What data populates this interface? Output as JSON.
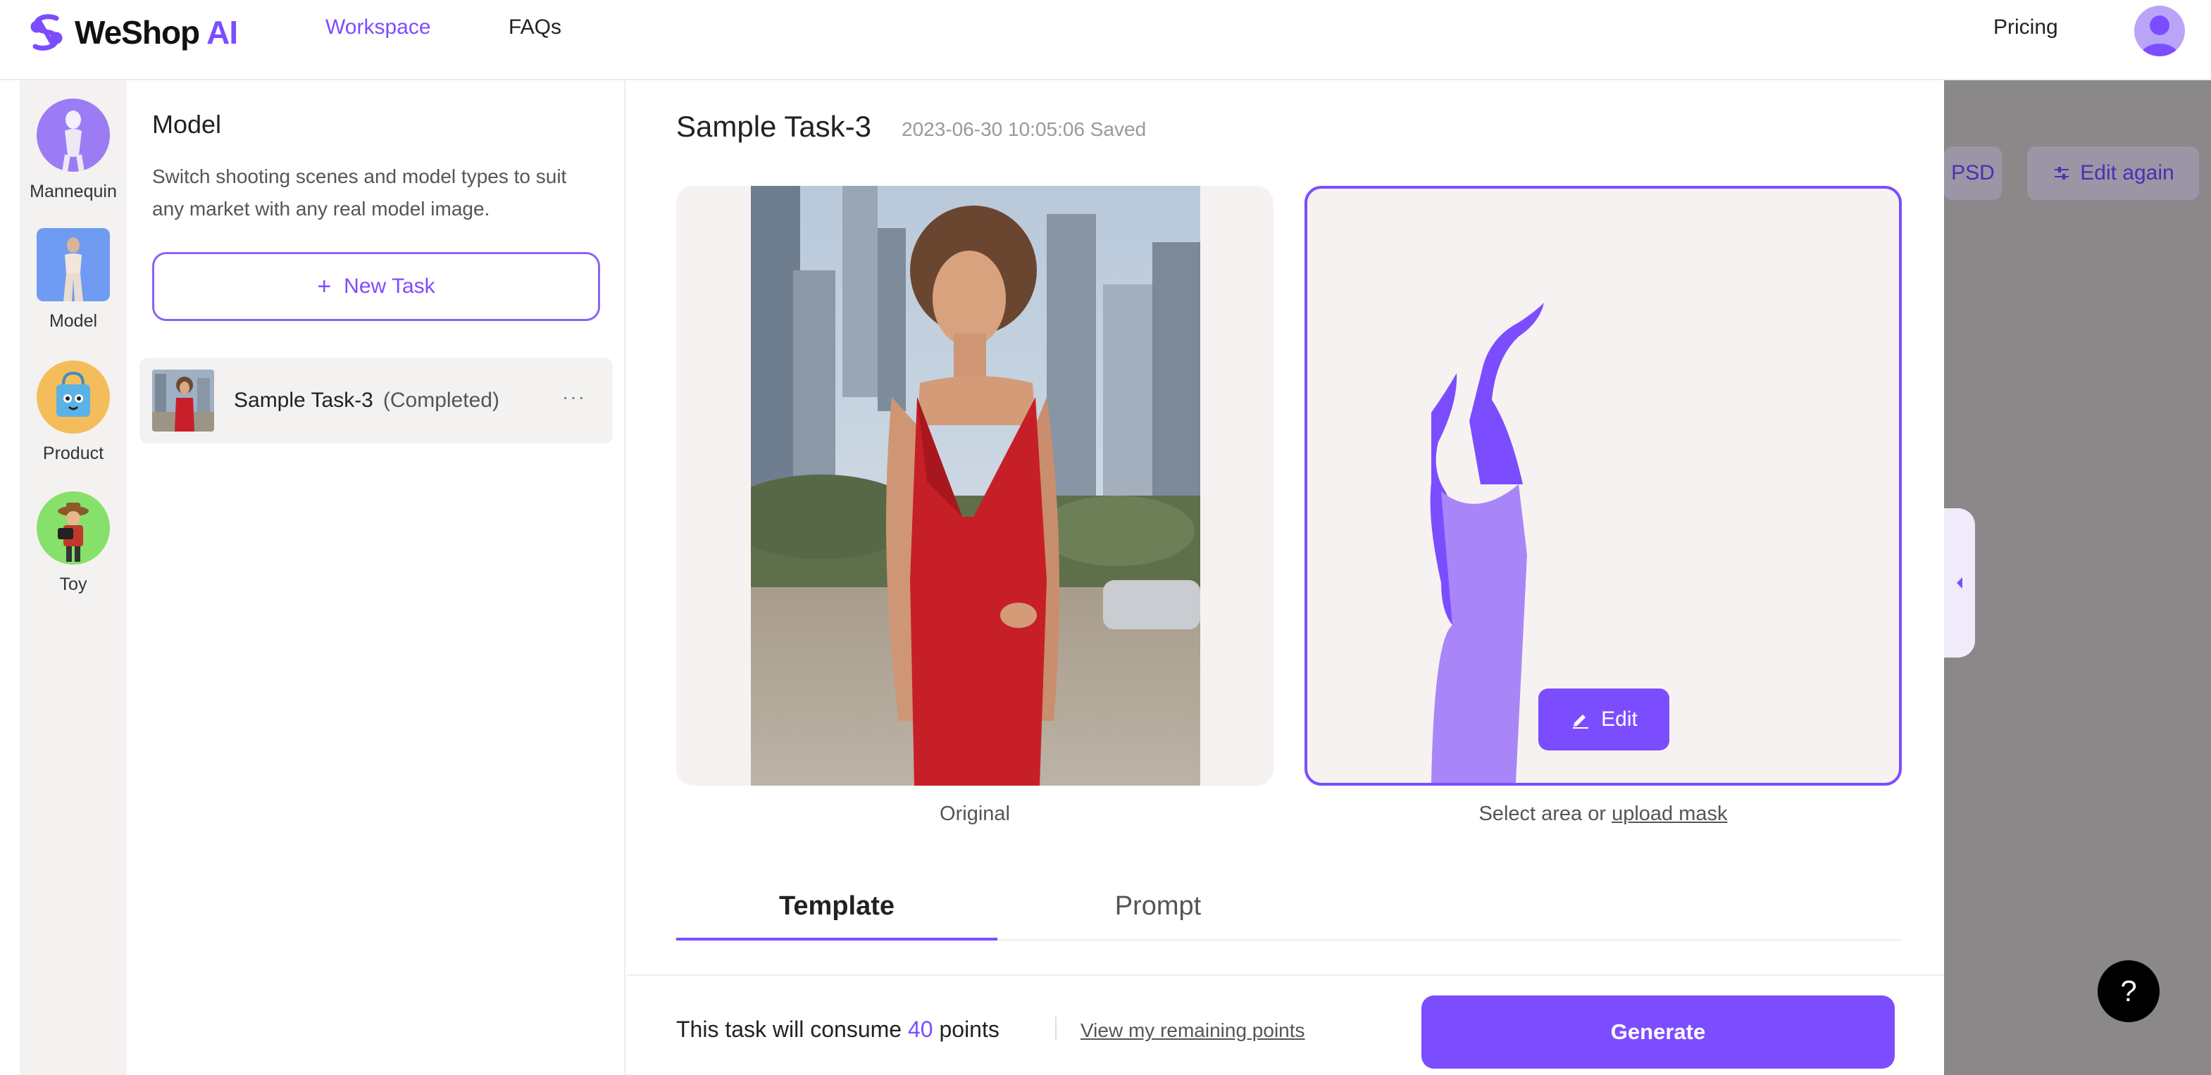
{
  "brand": {
    "name": "WeShop",
    "suffix": "AI",
    "accent": "#7c4dff"
  },
  "nav": {
    "workspace": "Workspace",
    "faqs": "FAQs",
    "pricing": "Pricing"
  },
  "categories": [
    {
      "label": "Mannequin",
      "icon": "mannequin-icon"
    },
    {
      "label": "Model",
      "icon": "model-icon"
    },
    {
      "label": "Product",
      "icon": "product-icon"
    },
    {
      "label": "Toy",
      "icon": "toy-icon"
    }
  ],
  "task_panel": {
    "title": "Model",
    "description": "Switch shooting scenes and model types to suit any market with any real model image.",
    "new_task": "New Task",
    "new_task_icon": "+",
    "tasks": [
      {
        "name": "Sample Task-3",
        "status": "(Completed)",
        "more": "···"
      }
    ]
  },
  "main": {
    "task_title": "Sample Task-3",
    "saved_meta": "2023-06-30 10:05:06 Saved",
    "original_caption": "Original",
    "mask_caption_prefix": "Select area or",
    "mask_caption_link": "upload mask",
    "edit_label": "Edit",
    "tabs": [
      {
        "label": "Template"
      },
      {
        "label": "Prompt"
      }
    ],
    "consume_prefix": "This task will consume",
    "consume_points": "40",
    "consume_suffix": "points",
    "remaining_link": "View my remaining points",
    "generate_label": "Generate"
  },
  "overlay": {
    "psd_label": "PSD",
    "edit_again_label": "Edit again"
  },
  "help": {
    "label": "?"
  }
}
